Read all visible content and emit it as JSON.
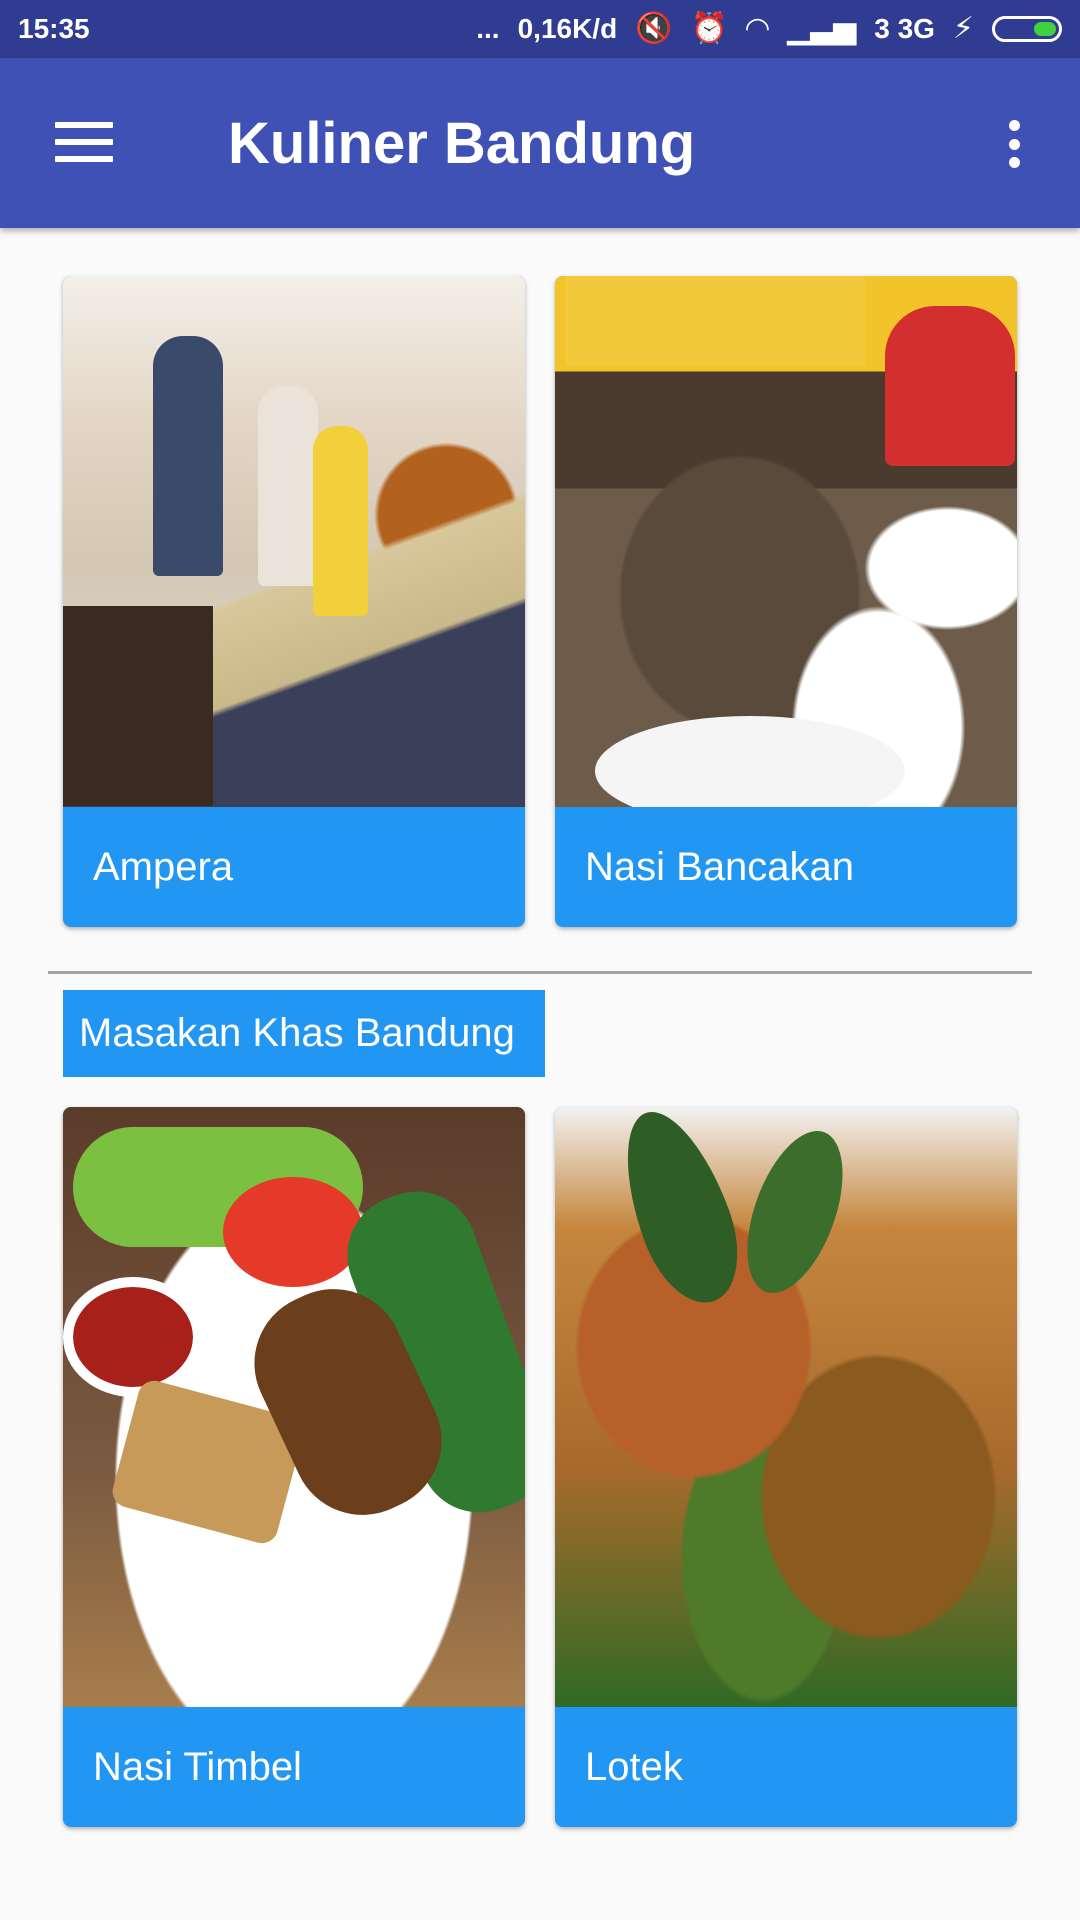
{
  "status_bar": {
    "time": "15:35",
    "dots": "...",
    "network_speed": "0,16K/d",
    "network_type": "3 3G",
    "icons": [
      "vibrate-off-icon",
      "alarm-icon",
      "wifi-icon",
      "signal-icon",
      "charging-icon",
      "battery-icon"
    ]
  },
  "app_bar": {
    "title": "Kuliner Bandung",
    "menu_icon": "hamburger-menu-icon",
    "overflow_icon": "more-vert-icon",
    "color": "#3f51b5"
  },
  "section_top": {
    "cards": [
      {
        "label": "Ampera"
      },
      {
        "label": "Nasi Bancakan"
      }
    ]
  },
  "section_khas": {
    "header": "Masakan Khas Bandung",
    "cards": [
      {
        "label": "Nasi Timbel"
      },
      {
        "label": "Lotek"
      }
    ]
  },
  "colors": {
    "accent": "#2196f3",
    "status_bar": "#2f3c92",
    "background": "#fafafa"
  }
}
